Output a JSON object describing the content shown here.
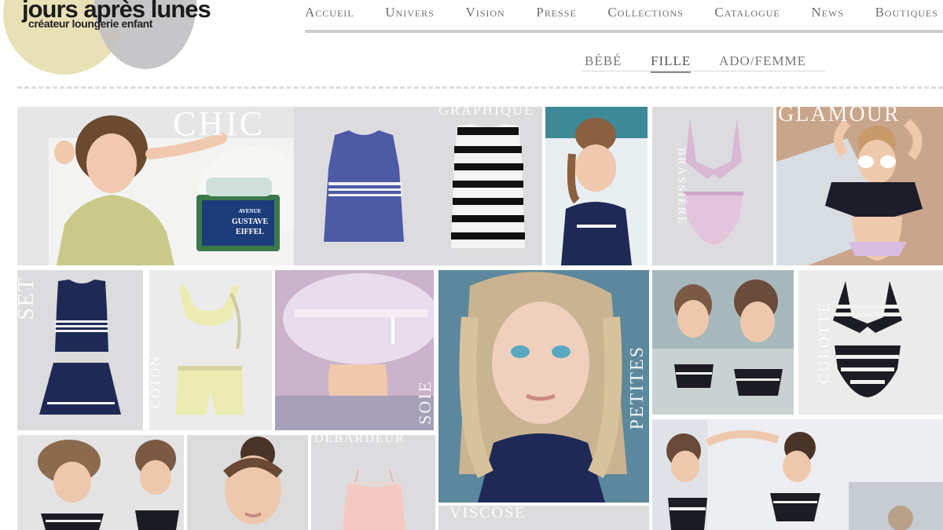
{
  "brand": {
    "name": "jours après lunes",
    "tagline": "créateur loungerie enfant"
  },
  "nav": {
    "items": [
      "Accueil",
      "Univers",
      "Vision",
      "Presse",
      "Collections",
      "Catalogue",
      "News",
      "Boutiques"
    ]
  },
  "subnav": {
    "items": [
      "BÉBÉ",
      "FILLE",
      "ADO/FEMME"
    ],
    "active": "FILLE"
  },
  "sign": {
    "line1": "AVENUE",
    "line2": "GUSTAVE",
    "line3": "EIFFEL"
  },
  "mosaic": {
    "labels": {
      "chic": "CHIC",
      "graphique": "GRAPHIQUE",
      "glamour": "GLAMOUR",
      "brassiere": "BRASSIÈRE",
      "set": "SET",
      "coton": "COTON",
      "soie": "SOIE",
      "culotte": "CULOTTE",
      "petites": "PETITES",
      "debardeur": "DÉBARDEUR",
      "viscose": "VISCOSE"
    }
  },
  "colors": {
    "logo_cream": "#e9e1b6",
    "logo_grey": "#c3c2c4",
    "nav_text": "#6f6f6f",
    "tile_bg": "#dcdcde",
    "navy": "#1e2a55",
    "lilac": "#d9b8d4",
    "teal": "#3d8a96"
  }
}
